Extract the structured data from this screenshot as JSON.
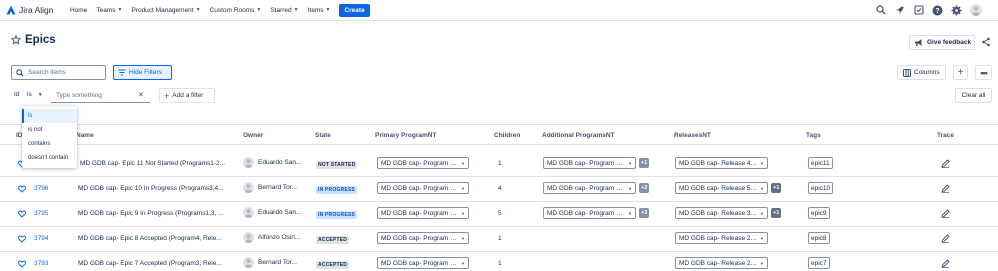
{
  "app": {
    "name": "Jira Align"
  },
  "nav": {
    "items": [
      {
        "label": "Home",
        "dropdown": false
      },
      {
        "label": "Teams",
        "dropdown": true
      },
      {
        "label": "Product Management",
        "dropdown": true
      },
      {
        "label": "Custom Rooms",
        "dropdown": true
      },
      {
        "label": "Starred",
        "dropdown": true
      },
      {
        "label": "Items",
        "dropdown": true
      }
    ],
    "create_label": "Create",
    "right_icons": [
      "search-icon",
      "rocket-icon",
      "checklist-icon",
      "help-icon",
      "settings-icon",
      "user-avatar"
    ]
  },
  "page": {
    "title": "Epics",
    "feedback_label": "Give feedback"
  },
  "toolbar": {
    "search_placeholder": "Search items",
    "hide_filters_label": "Hide Filters",
    "columns_label": "Columns",
    "clear_all_label": "Clear all"
  },
  "filter": {
    "field": "Id",
    "operator": "is",
    "value_placeholder": "Type something",
    "add_filter_label": "Add a filter",
    "operator_options": [
      "is",
      "is not",
      "contains",
      "doesn't contain"
    ],
    "selected_option": "is"
  },
  "table": {
    "columns": [
      "ID",
      "Name",
      "Owner",
      "State",
      "Primary ProgramNT",
      "Children",
      "Additional ProgramsNT",
      "ReleasesNT",
      "Tags",
      "Trace"
    ],
    "rows": [
      {
        "id": "",
        "name": "MD GDB cap- Epic 11 Not Started (Programs1-2...",
        "owner": "Eduardo San...",
        "state": "NOT STARTED",
        "state_kind": "ns",
        "primary_program": "MD GDB cap- Program 1 (...",
        "children": "1",
        "additional_programs": "MD GDB cap- Program 2 ...",
        "additional_more": "+1",
        "release": "MD GDB cap- Release 4: ...",
        "release_more": "",
        "tag": "epic11"
      },
      {
        "id": "3796",
        "name": "MD GDB cap- Epic 10 In Progress (Programs3,4...",
        "owner": "Bernard Tor...",
        "state": "IN PROGRESS",
        "state_kind": "ip",
        "primary_program": "MD GDB cap- Program 3 ...",
        "children": "4",
        "additional_programs": "MD GDB cap- Program 4 ...",
        "additional_more": "+2",
        "release": "MD GDB cap- Release 5: ...",
        "release_more": "+1",
        "tag": "epic10"
      },
      {
        "id": "3795",
        "name": "MD GDB cap- Epic 9 In Progress (Programs1,3, ...",
        "owner": "Eduardo San...",
        "state": "IN PROGRESS",
        "state_kind": "ip",
        "primary_program": "MD GDB cap- Program 1 (...",
        "children": "5",
        "additional_programs": "MD GDB cap- Program 2 ...",
        "additional_more": "+3",
        "release": "MD GDB cap- Release 3: ...",
        "release_more": "+1",
        "tag": "epic9"
      },
      {
        "id": "3794",
        "name": "MD GDB cap- Epic 8 Accepted (Program4, Rele...",
        "owner": "Alfonzo Osin...",
        "state": "ACCEPTED",
        "state_kind": "ac",
        "primary_program": "MD GDB cap- Program 4 ...",
        "children": "1",
        "additional_programs": "",
        "additional_more": "",
        "release": "MD GDB cap- Release 2: ...",
        "release_more": "",
        "tag": "epic8"
      },
      {
        "id": "3793",
        "name": "MD GDB cap- Epic 7 Accepted (Program3, Rele...",
        "owner": "Bernard Tor...",
        "state": "ACCEPTED",
        "state_kind": "ac",
        "primary_program": "MD GDB cap- Program 3 ...",
        "children": "1",
        "additional_programs": "",
        "additional_more": "",
        "release": "MD GDB cap- Release 2: ...",
        "release_more": "",
        "tag": "epic7"
      }
    ]
  },
  "colors": {
    "primary": "#0c66e4",
    "text": "#172b4d",
    "border": "#dfe1e6",
    "in_progress_bg": "#cce0ff"
  }
}
